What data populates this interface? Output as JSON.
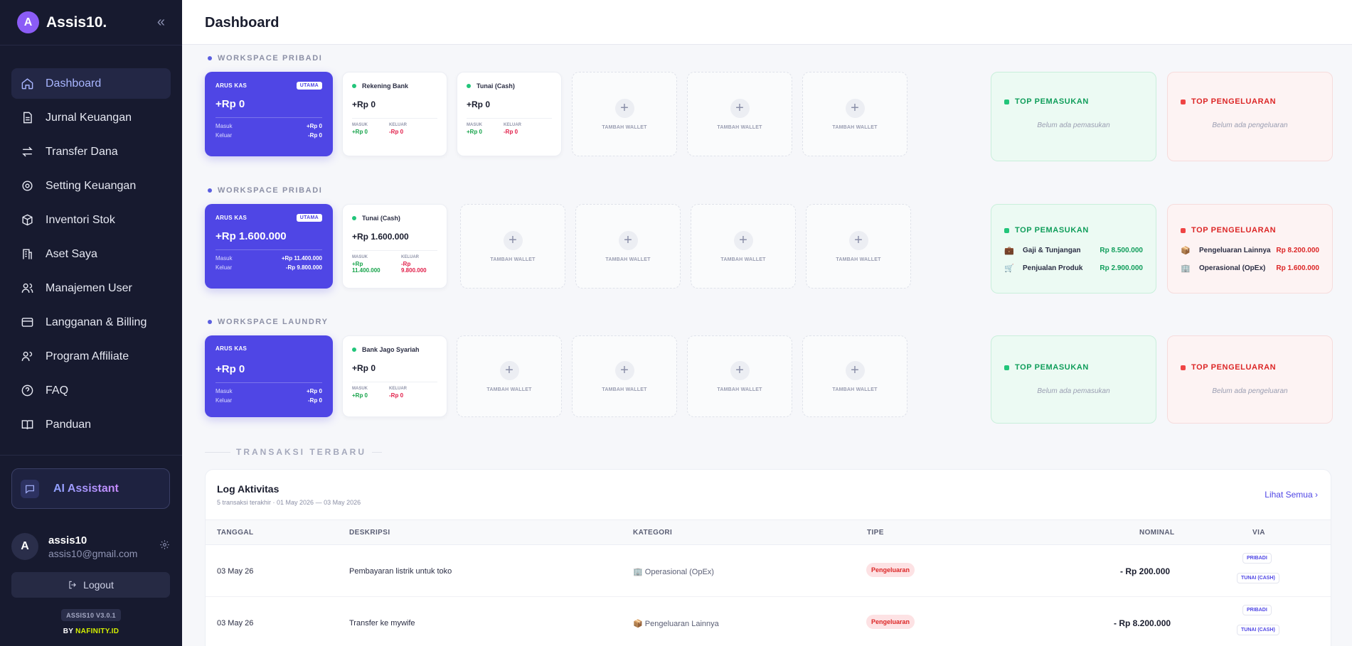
{
  "brand": {
    "initial": "A",
    "name": "Assis10."
  },
  "nav": [
    {
      "label": "Dashboard",
      "icon": "home-icon"
    },
    {
      "label": "Jurnal Keuangan",
      "icon": "document-icon"
    },
    {
      "label": "Transfer Dana",
      "icon": "transfer-icon"
    },
    {
      "label": "Setting Keuangan",
      "icon": "settings-icon"
    },
    {
      "label": "Inventori Stok",
      "icon": "box-icon"
    },
    {
      "label": "Aset Saya",
      "icon": "building-icon"
    },
    {
      "label": "Manajemen User",
      "icon": "users-icon"
    },
    {
      "label": "Langganan & Billing",
      "icon": "card-icon"
    },
    {
      "label": "Program Affiliate",
      "icon": "affiliate-icon"
    },
    {
      "label": "FAQ",
      "icon": "help-icon"
    },
    {
      "label": "Panduan",
      "icon": "book-icon"
    }
  ],
  "ai_assistant": "AI Assistant",
  "user": {
    "initial": "A",
    "name": "assis10",
    "email": "assis10@gmail.com"
  },
  "logout": "Logout",
  "version": "ASSIS10 V3.0.1",
  "by": {
    "prefix": "BY",
    "name": "NAFINITY.ID"
  },
  "page_title": "Dashboard",
  "common": {
    "arus_kas": "ARUS KAS",
    "utama": "UTAMA",
    "masuk": "Masuk",
    "keluar": "Keluar",
    "masuk_upper": "MASUK",
    "keluar_upper": "KELUAR",
    "tambah_wallet": "TAMBAH WALLET",
    "top_pemasukan": "TOP PEMASUKAN",
    "top_pengeluaran": "TOP PENGELUARAN",
    "empty_in": "Belum ada pemasukan",
    "empty_out": "Belum ada pengeluaran"
  },
  "workspaces": [
    {
      "label": "WORKSPACE PRIBADI",
      "cash": {
        "amount": "+Rp 0",
        "in": "+Rp 0",
        "out": "-Rp 0"
      },
      "wallets": [
        {
          "name": "Rekening Bank",
          "amount": "+Rp 0",
          "in": "+Rp 0",
          "out": "-Rp 0"
        },
        {
          "name": "Tunai (Cash)",
          "amount": "+Rp 0",
          "in": "+Rp 0",
          "out": "-Rp 0"
        }
      ]
    },
    {
      "label": "WORKSPACE PRIBADI",
      "cash": {
        "amount": "+Rp 1.600.000",
        "in": "+Rp 11.400.000",
        "out": "-Rp 9.800.000"
      },
      "wallets": [
        {
          "name": "Tunai (Cash)",
          "amount": "+Rp 1.600.000",
          "in": "+Rp 11.400.000",
          "out": "-Rp 9.800.000"
        }
      ],
      "top_in": [
        {
          "icon": "briefcase-icon",
          "name": "Gaji & Tunjangan",
          "value": "Rp 8.500.000"
        },
        {
          "icon": "cart-icon",
          "name": "Penjualan Produk",
          "value": "Rp 2.900.000"
        }
      ],
      "top_out": [
        {
          "icon": "tag-icon",
          "name": "Pengeluaran Lainnya",
          "value": "Rp 8.200.000"
        },
        {
          "icon": "office-icon",
          "name": "Operasional (OpEx)",
          "value": "Rp 1.600.000"
        }
      ]
    },
    {
      "label": "WORKSPACE LAUNDRY",
      "cash": {
        "amount": "+Rp 0",
        "in": "+Rp 0",
        "out": "-Rp 0"
      },
      "wallets": [
        {
          "name": "Bank Jago Syariah",
          "amount": "+Rp 0",
          "in": "+Rp 0",
          "out": "-Rp 0"
        }
      ]
    }
  ],
  "transactions_title": "TRANSAKSI TERBARU",
  "log": {
    "title": "Log Aktivitas",
    "subtitle": "5 transaksi terakhir · 01 May 2026 — 03 May 2026",
    "see_all": "Lihat Semua",
    "columns": {
      "date": "TANGGAL",
      "desc": "DESKRIPSI",
      "cat": "KATEGORI",
      "type": "TIPE",
      "nominal": "NOMINAL",
      "via": "VIA"
    },
    "rows": [
      {
        "date": "03 May 26",
        "desc": "Pembayaran listrik untuk toko",
        "cat": "Operasional (OpEx)",
        "type": "Pengeluaran",
        "nominal": "- Rp 200.000",
        "via1": "PRIBADI",
        "via2": "TUNAI (CASH)"
      },
      {
        "date": "03 May 26",
        "desc": "Transfer ke mywife",
        "cat": "Pengeluaran Lainnya",
        "type": "Pengeluaran",
        "nominal": "- Rp 8.200.000",
        "via1": "PRIBADI",
        "via2": "TUNAI (CASH)"
      }
    ]
  }
}
